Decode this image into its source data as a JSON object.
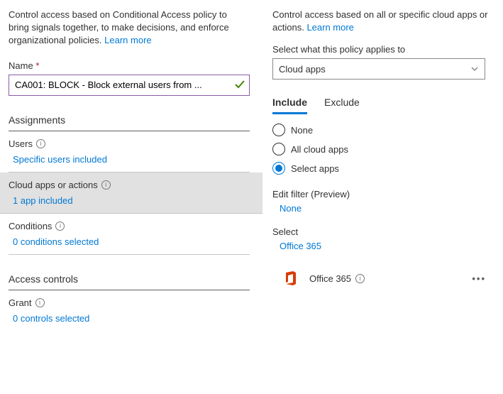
{
  "left": {
    "description": "Control access based on Conditional Access policy to bring signals together, to make decisions, and enforce organizational policies.",
    "learn_more": "Learn more",
    "name_label": "Name",
    "name_value": "CA001: BLOCK - Block external users from ...",
    "assignments_header": "Assignments",
    "users": {
      "title": "Users",
      "value": "Specific users included"
    },
    "cloud_apps": {
      "title": "Cloud apps or actions",
      "value": "1 app included"
    },
    "conditions": {
      "title": "Conditions",
      "value": "0 conditions selected"
    },
    "access_controls_header": "Access controls",
    "grant": {
      "title": "Grant",
      "value": "0 controls selected"
    }
  },
  "right": {
    "description": "Control access based on all or specific cloud apps or actions.",
    "learn_more": "Learn more",
    "applies_label": "Select what this policy applies to",
    "select_value": "Cloud apps",
    "tabs": {
      "include": "Include",
      "exclude": "Exclude"
    },
    "radios": {
      "none": "None",
      "all": "All cloud apps",
      "select": "Select apps"
    },
    "edit_filter_label": "Edit filter (Preview)",
    "edit_filter_value": "None",
    "select_label": "Select",
    "select_value_link": "Office 365",
    "app_item": {
      "name": "Office 365"
    }
  }
}
